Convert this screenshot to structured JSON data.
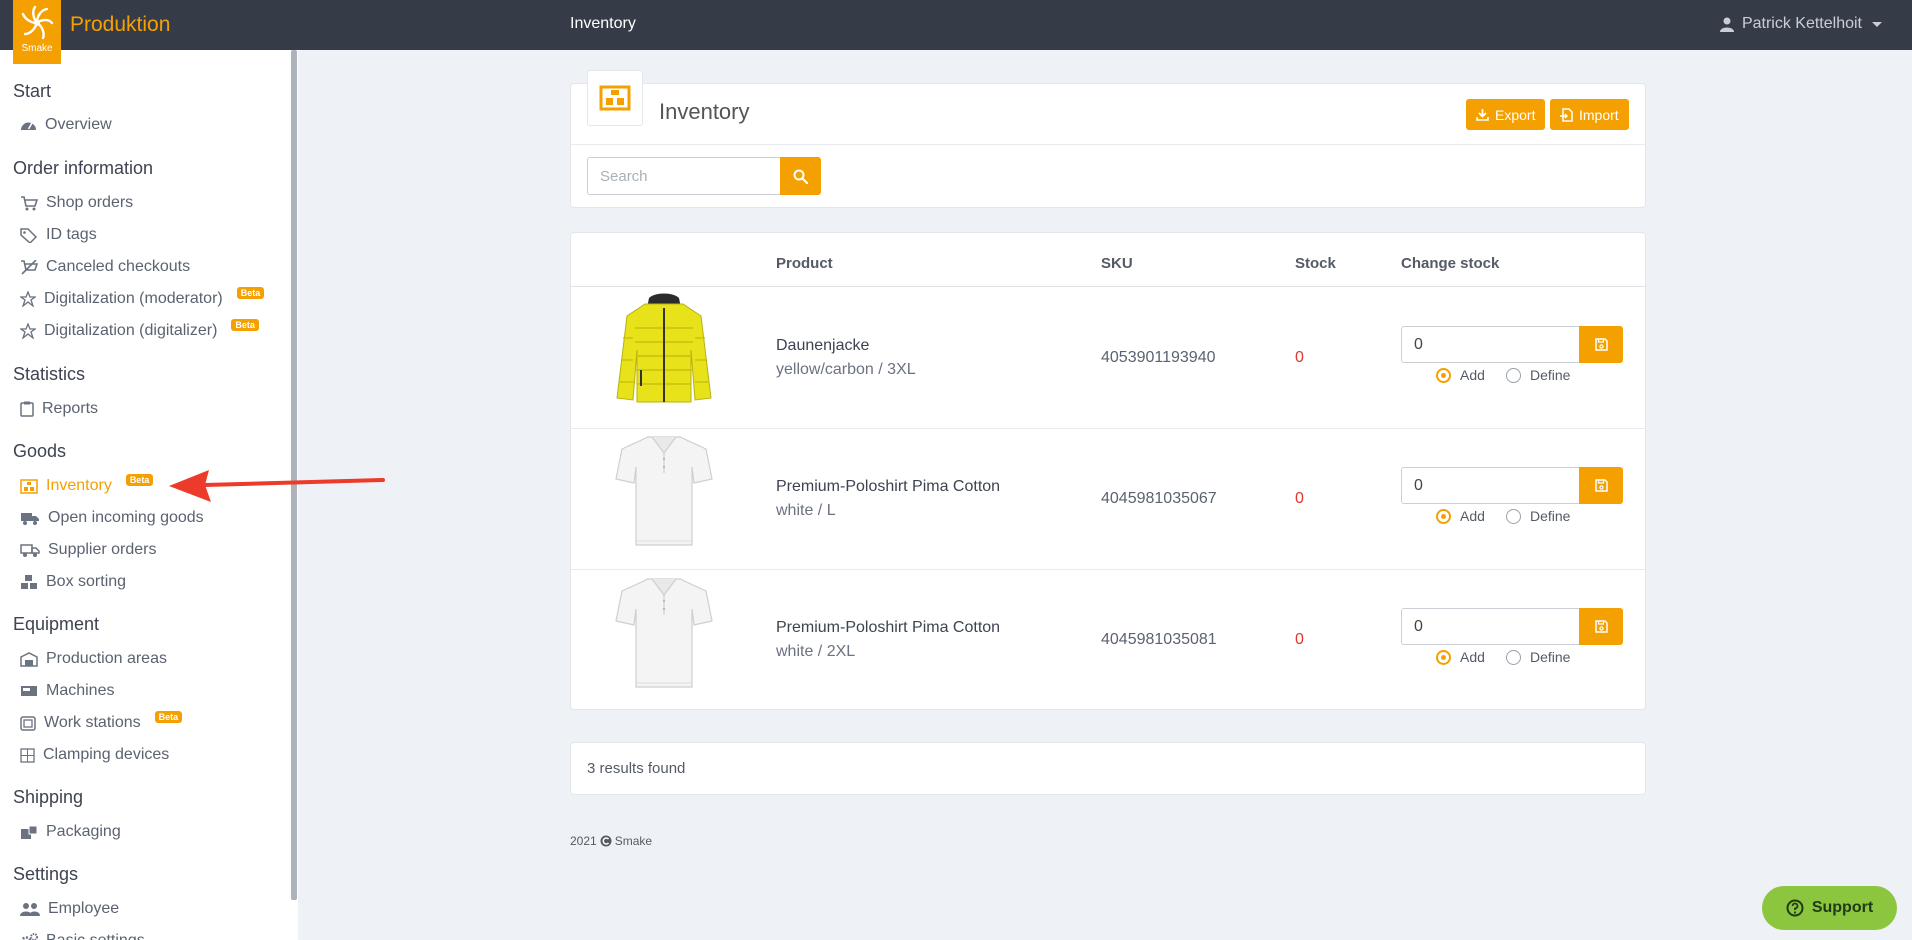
{
  "app": {
    "logo_text": "Smake",
    "brand": "Produktion",
    "page_title": "Inventory",
    "user_name": "Patrick Kettelhoit"
  },
  "sidebar": {
    "sections": [
      {
        "title": "Start",
        "items": [
          {
            "label": "Overview",
            "icon": "dashboard-icon"
          }
        ]
      },
      {
        "title": "Order information",
        "items": [
          {
            "label": "Shop orders",
            "icon": "cart-icon"
          },
          {
            "label": "ID tags",
            "icon": "tags-icon"
          },
          {
            "label": "Canceled checkouts",
            "icon": "cart-off-icon"
          },
          {
            "label": "Digitalization (moderator)",
            "icon": "magic-icon",
            "badge": "Beta"
          },
          {
            "label": "Digitalization (digitalizer)",
            "icon": "magic-icon",
            "badge": "Beta"
          }
        ]
      },
      {
        "title": "Statistics",
        "items": [
          {
            "label": "Reports",
            "icon": "clipboard-icon"
          }
        ]
      },
      {
        "title": "Goods",
        "items": [
          {
            "label": "Inventory",
            "icon": "inventory-icon",
            "badge": "Beta",
            "active": true
          },
          {
            "label": "Open incoming goods",
            "icon": "truck-icon"
          },
          {
            "label": "Supplier orders",
            "icon": "truck-icon"
          },
          {
            "label": "Box sorting",
            "icon": "boxes-icon"
          }
        ]
      },
      {
        "title": "Equipment",
        "items": [
          {
            "label": "Production areas",
            "icon": "warehouse-icon"
          },
          {
            "label": "Machines",
            "icon": "machine-icon"
          },
          {
            "label": "Work stations",
            "icon": "workstation-icon",
            "badge": "Beta"
          },
          {
            "label": "Clamping devices",
            "icon": "clamp-icon"
          }
        ]
      },
      {
        "title": "Shipping",
        "items": [
          {
            "label": "Packaging",
            "icon": "boxes-icon"
          }
        ]
      },
      {
        "title": "Settings",
        "items": [
          {
            "label": "Employee",
            "icon": "users-icon"
          },
          {
            "label": "Basic settings",
            "icon": "cogs-icon"
          }
        ]
      }
    ]
  },
  "inventory": {
    "title": "Inventory",
    "export_label": "Export",
    "import_label": "Import",
    "search_placeholder": "Search",
    "columns": {
      "product": "Product",
      "sku": "SKU",
      "stock": "Stock",
      "change_stock": "Change stock"
    },
    "rows": [
      {
        "product": "Daunenjacke",
        "variant": "yellow/carbon / 3XL",
        "sku": "4053901193940",
        "stock": "0",
        "change_value": "0",
        "mode": "Add",
        "image": "yellow-jacket"
      },
      {
        "product": "Premium-Poloshirt Pima Cotton",
        "variant": "white / L",
        "sku": "4045981035067",
        "stock": "0",
        "change_value": "0",
        "mode": "Add",
        "image": "white-polo"
      },
      {
        "product": "Premium-Poloshirt Pima Cotton",
        "variant": "white / 2XL",
        "sku": "4045981035081",
        "stock": "0",
        "change_value": "0",
        "mode": "Add",
        "image": "white-polo"
      }
    ],
    "radio_add": "Add",
    "radio_define": "Define",
    "results_text": "3 results found"
  },
  "footer": {
    "year": "2021",
    "company": "Smake"
  },
  "support": {
    "label": "Support"
  },
  "colors": {
    "accent": "#f5a001",
    "topbar": "#363c47",
    "stock_zero": "#e1342b",
    "support": "#8cc63f"
  }
}
